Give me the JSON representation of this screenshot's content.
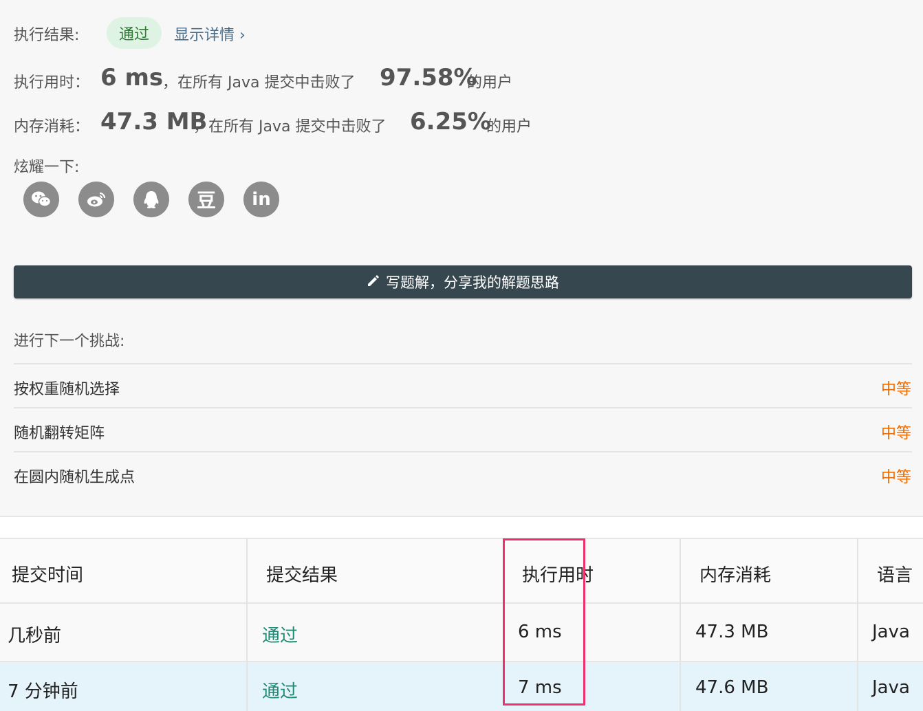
{
  "result": {
    "label": "执行结果:",
    "status": "通过",
    "details_link": "显示详情 ›"
  },
  "runtime": {
    "label": "执行用时：",
    "value": "6 ms",
    "middle": "，在所有 Java 提交中击败了",
    "percent": "97.58%",
    "suffix": "的用户"
  },
  "memory": {
    "label": "内存消耗：",
    "value": "47.3 MB",
    "middle": "，在所有 Java 提交中击败了",
    "percent": "6.25%",
    "suffix": "的用户"
  },
  "share": {
    "label": "炫耀一下:",
    "icons": [
      "wechat-icon",
      "weibo-icon",
      "qq-icon",
      "douban-icon",
      "linkedin-icon"
    ],
    "douban_glyph": "豆",
    "linkedin_glyph": "in"
  },
  "write_solution_button": "写题解，分享我的解题思路",
  "next_challenge": {
    "label": "进行下一个挑战:",
    "problems": [
      {
        "title": "按权重随机选择",
        "difficulty": "中等"
      },
      {
        "title": "随机翻转矩阵",
        "difficulty": "中等"
      },
      {
        "title": "在圆内随机生成点",
        "difficulty": "中等"
      }
    ]
  },
  "submissions": {
    "headers": [
      "提交时间",
      "提交结果",
      "执行用时",
      "内存消耗",
      "语言"
    ],
    "rows": [
      {
        "time": "几秒前",
        "result": "通过",
        "runtime": "6 ms",
        "memory": "47.3 MB",
        "language": "Java"
      },
      {
        "time": "7 分钟前",
        "result": "通过",
        "runtime": "7 ms",
        "memory": "47.6 MB",
        "language": "Java"
      }
    ]
  },
  "colors": {
    "accent_pass": "#1c8c74",
    "difficulty_medium": "#ef6c00",
    "highlight_box": "#f0306c",
    "button_bg": "#37474f"
  }
}
